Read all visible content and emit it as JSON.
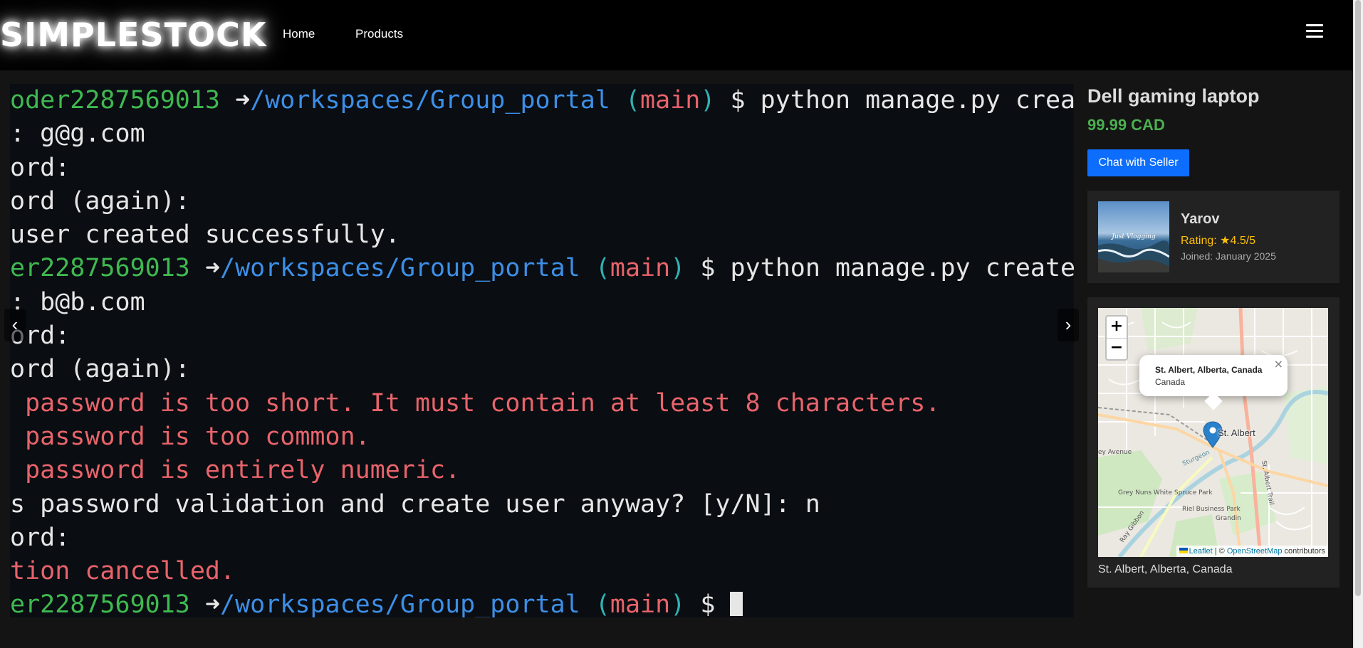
{
  "header": {
    "logo": "SIMPLESTOCK",
    "nav": [
      "Home",
      "Products"
    ],
    "menu_icon": "hamburger-icon"
  },
  "carousel": {
    "prev_label": "‹",
    "next_label": "›",
    "terminal_lines": [
      [
        {
          "t": "oder2287569013 ",
          "c": "green"
        },
        {
          "t": "➜",
          "c": "white"
        },
        {
          "t": "/workspaces/Group_portal ",
          "c": "blue"
        },
        {
          "t": "(",
          "c": "teal"
        },
        {
          "t": "main",
          "c": "red"
        },
        {
          "t": ")",
          "c": "teal"
        },
        {
          "t": " $ python manage.py createsupe",
          "c": "white"
        }
      ],
      [
        {
          "t": ": g@g.com",
          "c": "white"
        }
      ],
      [
        {
          "t": "ord:",
          "c": "white"
        }
      ],
      [
        {
          "t": "ord (again):",
          "c": "white"
        }
      ],
      [
        {
          "t": "user created successfully.",
          "c": "white"
        }
      ],
      [
        {
          "t": "er2287569013 ",
          "c": "green"
        },
        {
          "t": "➜",
          "c": "white"
        },
        {
          "t": "/workspaces/Group_portal ",
          "c": "blue"
        },
        {
          "t": "(",
          "c": "teal"
        },
        {
          "t": "main",
          "c": "red"
        },
        {
          "t": ")",
          "c": "teal"
        },
        {
          "t": " $ python manage.py createsuperu",
          "c": "white"
        }
      ],
      [
        {
          "t": ": b@b.com",
          "c": "white"
        }
      ],
      [
        {
          "t": "ord:",
          "c": "white"
        }
      ],
      [
        {
          "t": "ord (again):",
          "c": "white"
        }
      ],
      [
        {
          "t": " password is too short. It must contain at least 8 characters.",
          "c": "red"
        }
      ],
      [
        {
          "t": " password is too common.",
          "c": "red"
        }
      ],
      [
        {
          "t": " password is entirely numeric.",
          "c": "red"
        }
      ],
      [
        {
          "t": "s password validation and create user anyway? [y/N]: n",
          "c": "white"
        }
      ],
      [
        {
          "t": "ord:",
          "c": "white"
        }
      ],
      [
        {
          "t": "tion cancelled.",
          "c": "red"
        }
      ],
      [
        {
          "t": "er2287569013 ",
          "c": "green"
        },
        {
          "t": "➜",
          "c": "white"
        },
        {
          "t": "/workspaces/Group_portal ",
          "c": "blue"
        },
        {
          "t": "(",
          "c": "teal"
        },
        {
          "t": "main",
          "c": "red"
        },
        {
          "t": ")",
          "c": "teal"
        },
        {
          "t": " $ ",
          "c": "white"
        }
      ]
    ]
  },
  "product": {
    "title": "Dell gaming laptop",
    "price": "99.99 CAD",
    "chat_button": "Chat with Seller"
  },
  "seller": {
    "name": "Yarov",
    "rating": "Rating: ★4.5/5",
    "joined": "Joined: January 2025",
    "avatar_text": "Just Vlogging"
  },
  "map": {
    "zoom_in": "+",
    "zoom_out": "−",
    "popup_title": "St. Albert, Alberta, Canada",
    "popup_subtitle": "Canada",
    "popup_close": "×",
    "place_label": "St. Albert",
    "street_labels": [
      "Grey Nuns White Spruce Park",
      "Riel Business Park",
      "Grandin",
      "St. Albert Trail",
      "Ray Gibbon",
      "ey Avenue",
      "Sturgeon"
    ],
    "attribution_leaflet": "Leaflet",
    "attribution_sep": " | © ",
    "attribution_osm": "OpenStreetMap",
    "attribution_tail": " contributors",
    "caption": "St. Albert, Alberta, Canada"
  },
  "colors": {
    "price": "#4caf50",
    "rating": "#ffc107",
    "button": "#0d6efd",
    "marker": "#2a81cb"
  }
}
